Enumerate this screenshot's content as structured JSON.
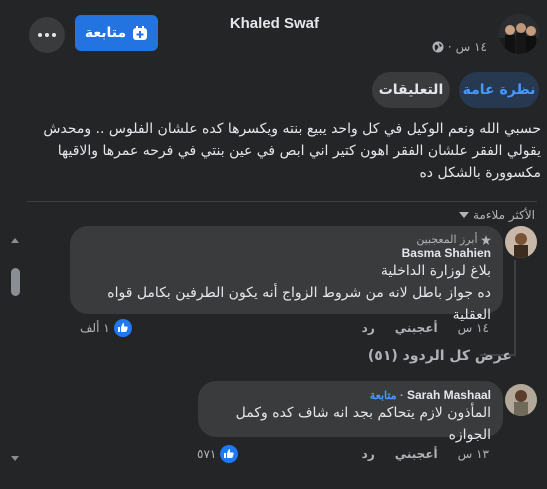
{
  "post": {
    "author": "Khaled Swaf",
    "time": "١٤ س",
    "follow_label": "متابعة",
    "text": "حسبي الله ونعم الوكيل في كل واحد يبيع بنته ويكسرها كده علشان الفلوس .. ومحدش يقولي الفقر علشان الفقر اهون كتير اني ابص في عين بنتي في فرحه عمرها والاقيها مكسوورة بالشكل ده"
  },
  "tabs": [
    {
      "label": "نظرة عامة",
      "active": true
    },
    {
      "label": "التعليقات",
      "active": false
    }
  ],
  "sort_label": "الأكثر ملاءمة",
  "comments": [
    {
      "badge": "أبرز المعجبين",
      "author": "Basma Shahien",
      "lines": [
        "بلاغ لوزارة الداخلية",
        "ده جواز باطل لانه من شروط الزواج أنه يكون الطرفين بكامل قواه العقلية"
      ],
      "time": "١٤ س",
      "like_label": "أعجبني",
      "reply_label": "رد",
      "reaction_count": "١ ألف"
    },
    {
      "author": "Sarah Mashaal",
      "follow_label": "متابعة",
      "lines": [
        "المأذون لازم يتحاكم بجد انه شاف كده وكمل الجوازه"
      ],
      "time": "١٣ س",
      "like_label": "أعجبني",
      "reply_label": "رد",
      "reaction_count": "٥٧١"
    }
  ],
  "view_replies": "عرض كل الردود (٥١)",
  "colors": {
    "background": "#242526",
    "bubble": "#3a3b3c",
    "accent": "#2374e1",
    "link": "#4599ff",
    "text": "#e4e6eb",
    "secondary_text": "#b0b3b8"
  }
}
